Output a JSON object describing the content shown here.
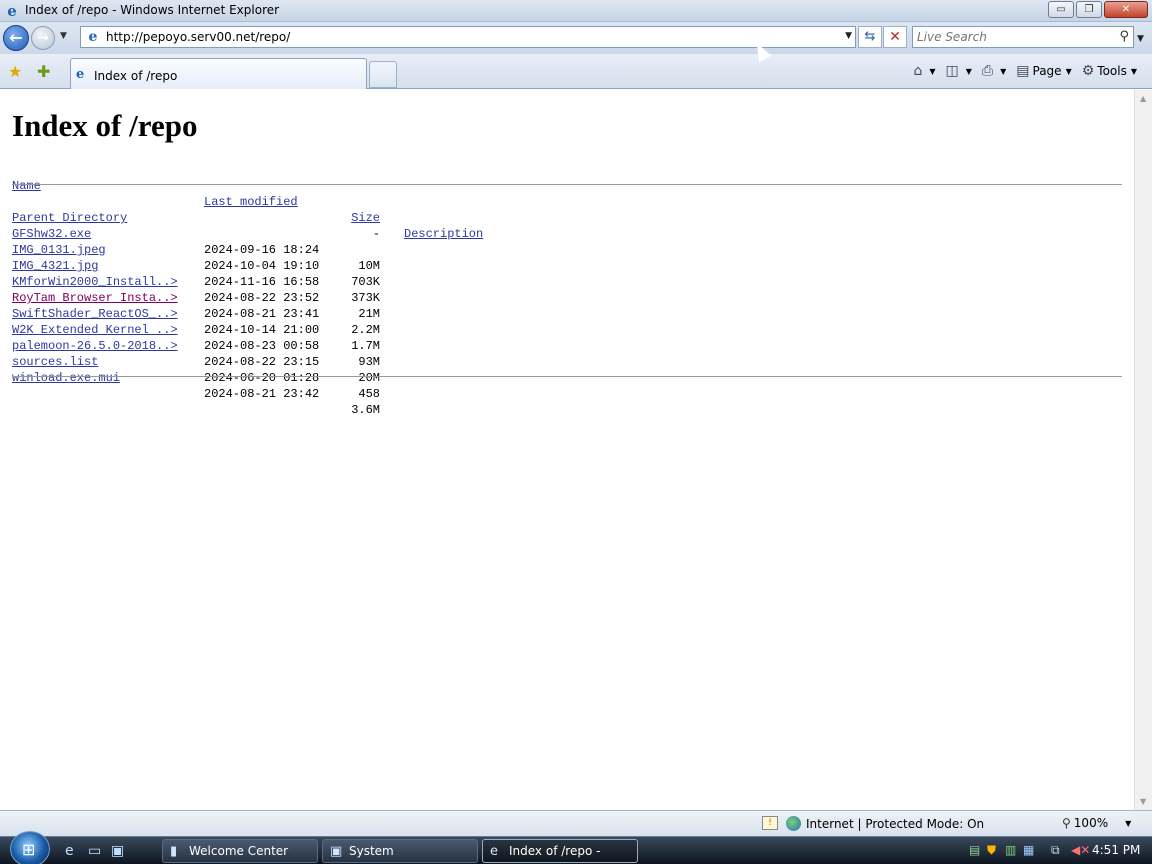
{
  "window": {
    "title": "Index of /repo - Windows Internet Explorer",
    "minimize": "▭",
    "maximize": "❐",
    "close": "✕"
  },
  "nav": {
    "url": "http://pepoyo.serv00.net/repo/",
    "search_placeholder": "Live Search"
  },
  "tabs": [
    {
      "label": "Index of /repo"
    }
  ],
  "commands": {
    "page_label": "Page",
    "tools_label": "Tools"
  },
  "page": {
    "heading": "Index of /repo",
    "columns": {
      "name": "Name",
      "last_modified": "Last modified",
      "size": "Size",
      "description": "Description"
    },
    "parent": {
      "name": "Parent Directory",
      "size": "-"
    },
    "entries": [
      {
        "name": "GFShw32.exe",
        "modified": "2024-09-16 18:24",
        "size": "10M"
      },
      {
        "name": "IMG_0131.jpeg",
        "modified": "2024-10-04 19:10",
        "size": "703K"
      },
      {
        "name": "IMG_4321.jpg",
        "modified": "2024-11-16 16:58",
        "size": "373K"
      },
      {
        "name": "KMforWin2000_Install..>",
        "modified": "2024-08-22 23:52",
        "size": "21M"
      },
      {
        "name": "RoyTam Browser Insta..>",
        "modified": "2024-08-21 23:41",
        "size": "2.2M"
      },
      {
        "name": "SwiftShader_ReactOS_..>",
        "modified": "2024-10-14 21:00",
        "size": "1.7M"
      },
      {
        "name": "W2K Extended Kernel ..>",
        "modified": "2024-08-23 00:58",
        "size": "93M"
      },
      {
        "name": "palemoon-26.5.0-2018..>",
        "modified": "2024-08-22 23:15",
        "size": "20M"
      },
      {
        "name": "sources.list",
        "modified": "2024-06-20 01:28",
        "size": "458"
      },
      {
        "name": "winload.exe.mui",
        "modified": "2024-08-21 23:42",
        "size": "3.6M"
      }
    ]
  },
  "status": {
    "zone": "Internet | Protected Mode: On",
    "zoom": "100%"
  },
  "taskbar": {
    "items": [
      {
        "label": "Welcome Center"
      },
      {
        "label": "System"
      },
      {
        "label": "Index of /repo - Win..."
      }
    ],
    "clock": "4:51 PM"
  },
  "colors": {
    "link": "#2b3aa0",
    "visited_link": "#800060",
    "title_bar": "#c6d4e6",
    "taskbar": "#0d1520"
  }
}
